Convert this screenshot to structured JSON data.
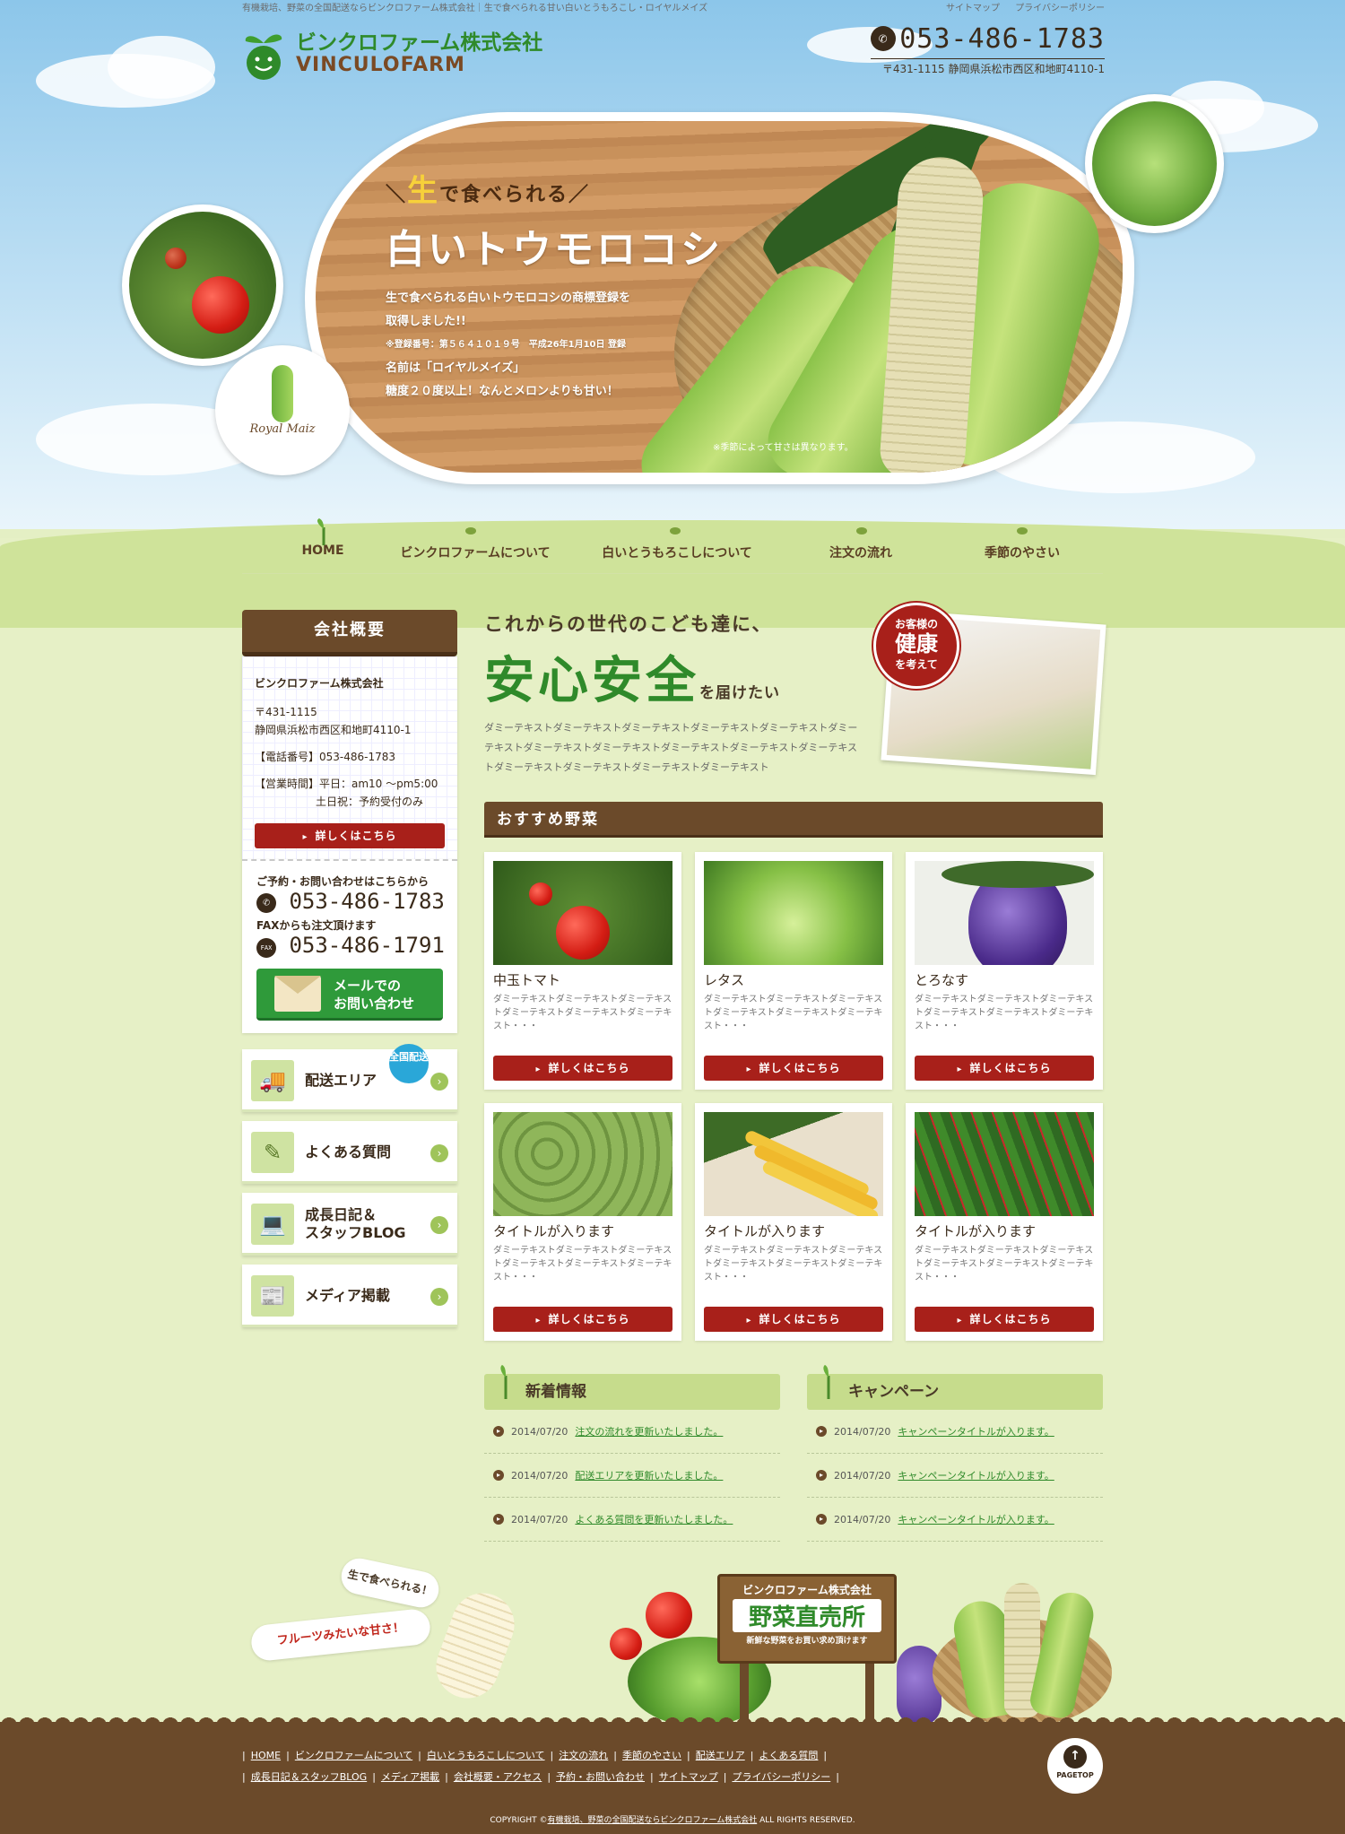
{
  "header": {
    "tagline": "有機栽培、野菜の全国配送ならビンクロファーム株式会社｜生で食べられる甘い白いとうもろこし・ロイヤルメイズ",
    "top_links": [
      "サイトマップ",
      "プライバシーポリシー"
    ],
    "logo_jp": "ビンクロファーム株式会社",
    "logo_en": "VINCULOFARM",
    "phone": "053-486-1783",
    "address": "〒431-1115 静岡県浜松市西区和地町4110-1"
  },
  "hero": {
    "lead_pre": "＼",
    "lead_accent": "生",
    "lead_rest": "で食べられる／",
    "headline": "白いトウモロコシ",
    "line1": "生で食べられる白いトウモロコシの商標登録を",
    "line2": "取得しました!!",
    "line3": "※登録番号：第５６４１０１９号　平成26年1月10日 登録",
    "line4": "名前は「ロイヤルメイズ」",
    "line5": "糖度２０度以上！なんとメロンよりも甘い！",
    "note": "※季節によって甘さは異なります。",
    "badge_text": "Royal Maiz"
  },
  "nav": {
    "items": [
      "HOME",
      "ビンクロファームについて",
      "白いとうもろこしについて",
      "注文の流れ",
      "季節のやさい"
    ]
  },
  "sidebar": {
    "title": "会社概要",
    "company": "ビンクロファーム株式会社",
    "zip": "〒431-1115",
    "address": "静岡県浜松市西区和地町4110-1",
    "tel_line": "【電話番号】053-486-1783",
    "hours_line": "【営業時間】平日：am10 〜pm5:00",
    "weekend_line": "土日祝：予約受付のみ",
    "detail_button": "詳しくはこちら",
    "contact_label": "ご予約・お問い合わせはこちらから",
    "contact_tel": "053-486-1783",
    "fax_label": "FAXからも注文頂けます",
    "fax_icon": "FAX",
    "fax_num": "053-486-1791",
    "mail_button_l1": "メールでの",
    "mail_button_l2": "お問い合わせ",
    "links": [
      {
        "label": "配送エリア",
        "label2": "",
        "badge": "全国配送"
      },
      {
        "label": "よくある質問",
        "label2": ""
      },
      {
        "label": "成長日記＆",
        "label2": "スタッフBLOG"
      },
      {
        "label": "メディア掲載",
        "label2": ""
      }
    ]
  },
  "intro": {
    "h1": "これからの世代のこども達に、",
    "h2": "安心安全",
    "h2_suffix": "を届けたい",
    "text": "ダミーテキストダミーテキストダミーテキストダミーテキストダミーテキストダミーテキストダミーテキストダミーテキストダミーテキストダミーテキストダミーテキストダミーテキストダミーテキストダミーテキストダミーテキスト",
    "seal_l1": "お客様の",
    "seal_l2": "健康",
    "seal_l3": "を考えて"
  },
  "recommended": {
    "title": "おすすめ野菜",
    "cards": [
      {
        "title": "中玉トマト",
        "desc": "ダミーテキストダミーテキストダミーテキストダミーテキストダミーテキストダミーテキスト・・・",
        "button": "詳しくはこちら"
      },
      {
        "title": "レタス",
        "desc": "ダミーテキストダミーテキストダミーテキストダミーテキストダミーテキストダミーテキスト・・・",
        "button": "詳しくはこちら"
      },
      {
        "title": "とろなす",
        "desc": "ダミーテキストダミーテキストダミーテキストダミーテキストダミーテキストダミーテキスト・・・",
        "button": "詳しくはこちら"
      },
      {
        "title": "タイトルが入ります",
        "desc": "ダミーテキストダミーテキストダミーテキストダミーテキストダミーテキストダミーテキスト・・・",
        "button": "詳しくはこちら"
      },
      {
        "title": "タイトルが入ります",
        "desc": "ダミーテキストダミーテキストダミーテキストダミーテキストダミーテキストダミーテキスト・・・",
        "button": "詳しくはこちら"
      },
      {
        "title": "タイトルが入ります",
        "desc": "ダミーテキストダミーテキストダミーテキストダミーテキストダミーテキストダミーテキスト・・・",
        "button": "詳しくはこちら"
      }
    ]
  },
  "news": {
    "title": "新着情報",
    "rows": [
      {
        "date": "2014/07/20",
        "text": "注文の流れを更新いたしました。"
      },
      {
        "date": "2014/07/20",
        "text": "配送エリアを更新いたしました。"
      },
      {
        "date": "2014/07/20",
        "text": "よくある質問を更新いたしました。"
      }
    ]
  },
  "campaign": {
    "title": "キャンペーン",
    "rows": [
      {
        "date": "2014/07/20",
        "text": "キャンペーンタイトルが入ります。"
      },
      {
        "date": "2014/07/20",
        "text": "キャンペーンタイトルが入ります。"
      },
      {
        "date": "2014/07/20",
        "text": "キャンペーンタイトルが入ります。"
      }
    ]
  },
  "banner": {
    "bubble1": "生で食べられる！",
    "bubble2": "フルーツみたいな甘さ！",
    "sign_l1": "ビンクロファーム株式会社",
    "sign_l2": "野菜直売所",
    "sign_l3": "新鮮な野菜をお買い求め頂けます"
  },
  "footer": {
    "row1": [
      "HOME",
      "ビンクロファームについて",
      "白いとうもろこしについて",
      "注文の流れ",
      "季節のやさい",
      "配送エリア",
      "よくある質問"
    ],
    "row2": [
      "成長日記＆スタッフBLOG",
      "メディア掲載",
      "会社概要・アクセス",
      "予約・お問い合わせ",
      "サイトマップ",
      "プライバシーポリシー"
    ],
    "copyright_pre": "COPYRIGHT ©",
    "copyright_link": "有機栽培、野菜の全国配送ならビンクロファーム株式会社",
    "copyright_post": " ALL RIGHTS RESERVED.",
    "pagetop": "PAGETOP"
  },
  "colors": {
    "brand_green": "#2f8a2a",
    "brown": "#6b4a2a",
    "button_red": "#a8201a"
  }
}
